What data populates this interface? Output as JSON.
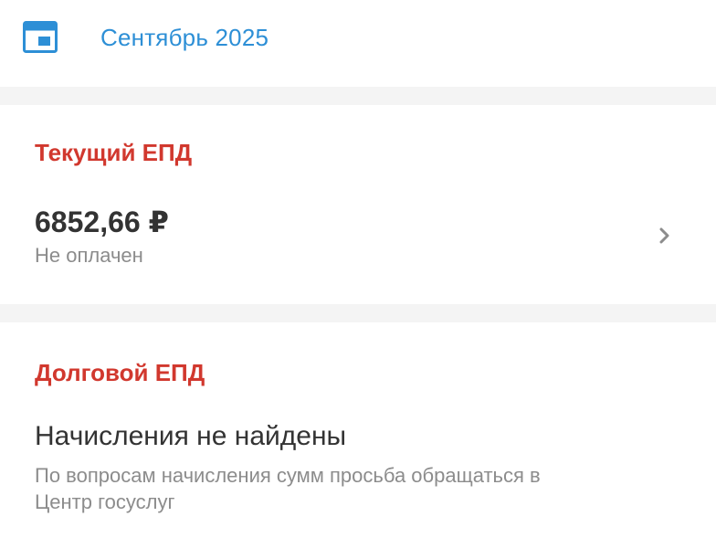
{
  "header": {
    "calendar_icon": "calendar-icon",
    "month": "Сентябрь 2025",
    "accent_color": "#2d8fd6"
  },
  "current_epd": {
    "title": "Текущий ЕПД",
    "amount": "6852,66 ₽",
    "status": "Не оплачен",
    "chevron_icon": "chevron-right-icon"
  },
  "debt_epd": {
    "title": "Долговой ЕПД",
    "message": "Начисления не найдены",
    "hint": "По вопросам начисления сумм просьба обращаться в Центр госуслуг"
  },
  "colors": {
    "section_title": "#d1382e",
    "primary_text": "#333333",
    "secondary_text": "#8c8c8c",
    "divider": "#f4f4f4"
  }
}
